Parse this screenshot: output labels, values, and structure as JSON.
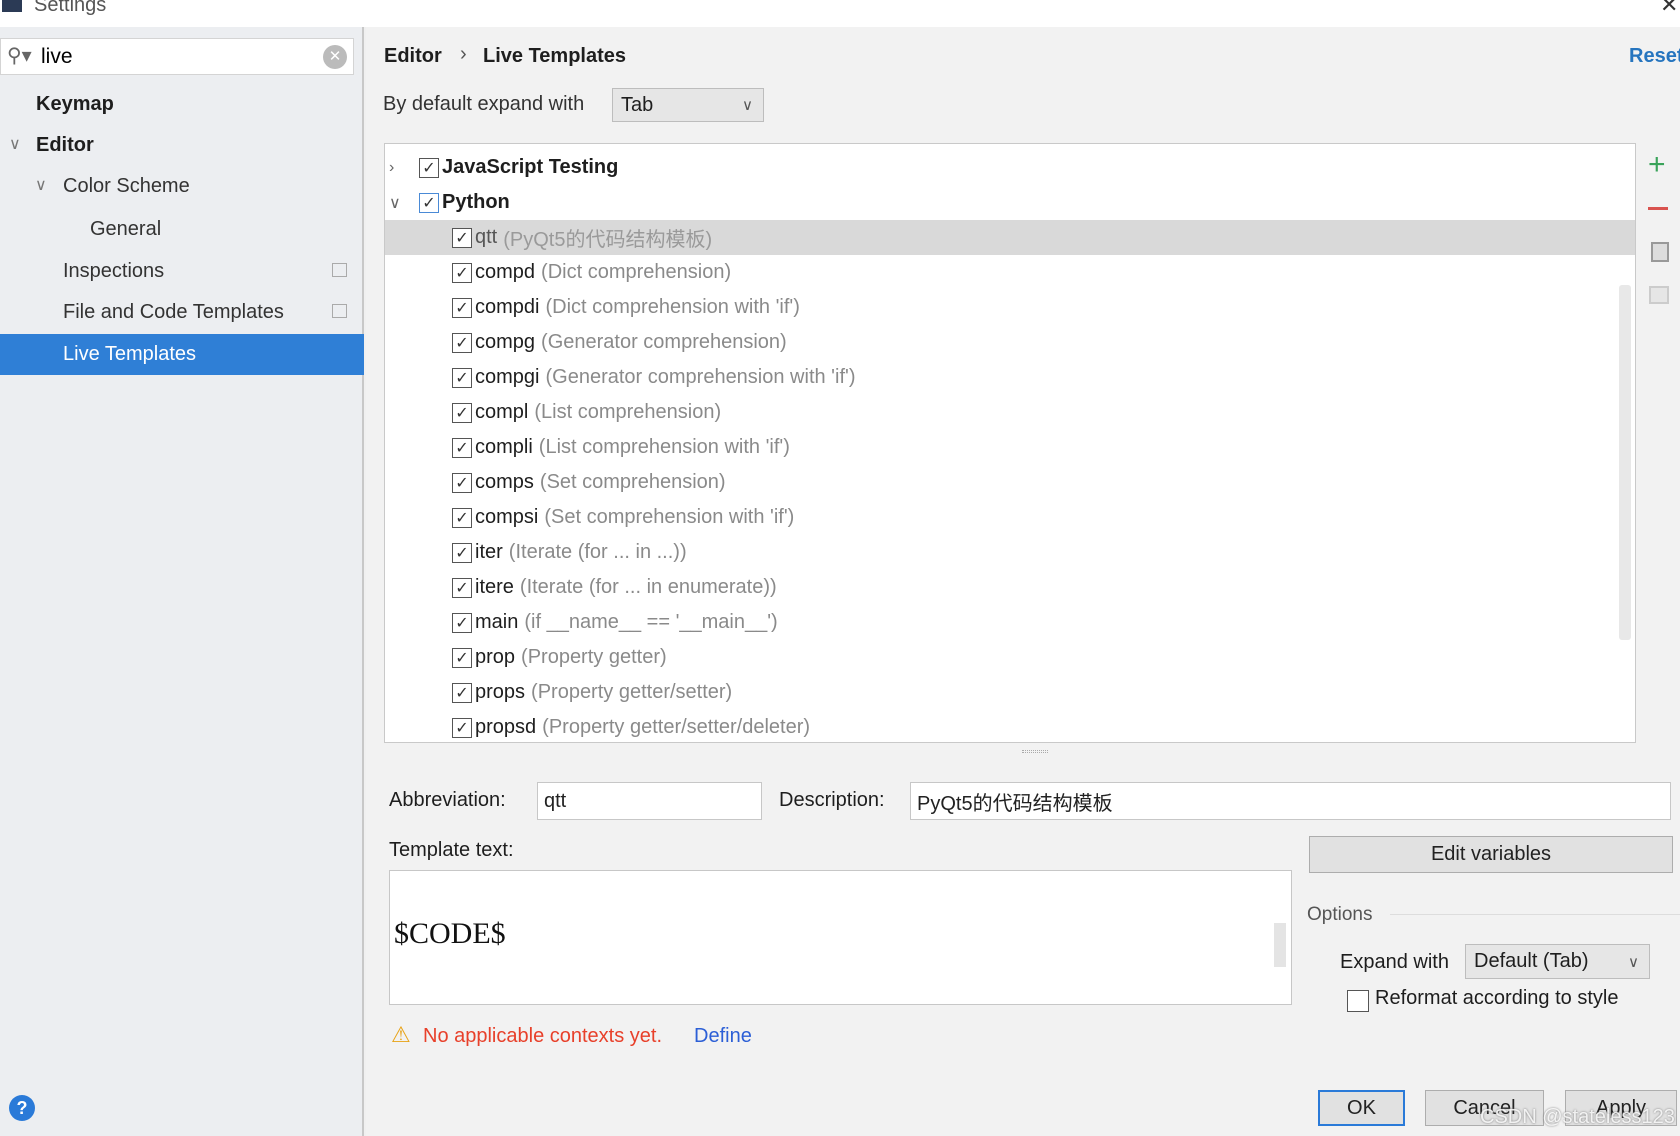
{
  "window": {
    "title": "Settings"
  },
  "search": {
    "value": "live"
  },
  "sidebar": {
    "items": [
      {
        "label": "Keymap",
        "bold": true
      },
      {
        "label": "Editor",
        "bold": true
      },
      {
        "label": "Color Scheme"
      },
      {
        "label": "General"
      },
      {
        "label": "Inspections"
      },
      {
        "label": "File and Code Templates"
      },
      {
        "label": "Live Templates",
        "selected": true
      }
    ]
  },
  "header": {
    "breadcrumb": [
      "Editor",
      "Live Templates"
    ],
    "reset": "Reset"
  },
  "expand": {
    "label": "By default expand with",
    "value": "Tab"
  },
  "tree": {
    "groups": [
      {
        "label": "JavaScript Testing",
        "checked": true,
        "expanded": false
      },
      {
        "label": "Python",
        "checked": true,
        "expanded": true
      }
    ],
    "items": [
      {
        "abbr": "qtt",
        "desc": "(PyQt5的代码结构模板)",
        "selected": true
      },
      {
        "abbr": "compd",
        "desc": "(Dict comprehension)"
      },
      {
        "abbr": "compdi",
        "desc": "(Dict comprehension with 'if')"
      },
      {
        "abbr": "compg",
        "desc": "(Generator comprehension)"
      },
      {
        "abbr": "compgi",
        "desc": "(Generator comprehension with 'if')"
      },
      {
        "abbr": "compl",
        "desc": "(List comprehension)"
      },
      {
        "abbr": "compli",
        "desc": "(List comprehension with 'if')"
      },
      {
        "abbr": "comps",
        "desc": "(Set comprehension)"
      },
      {
        "abbr": "compsi",
        "desc": "(Set comprehension with 'if')"
      },
      {
        "abbr": "iter",
        "desc": "(Iterate (for ... in ...))"
      },
      {
        "abbr": "itere",
        "desc": "(Iterate (for ... in enumerate))"
      },
      {
        "abbr": "main",
        "desc": "(if __name__ == '__main__')"
      },
      {
        "abbr": "prop",
        "desc": "(Property getter)"
      },
      {
        "abbr": "props",
        "desc": "(Property getter/setter)"
      },
      {
        "abbr": "propsd",
        "desc": "(Property getter/setter/deleter)"
      }
    ]
  },
  "editor": {
    "abbreviation_label": "Abbreviation:",
    "abbreviation": "qtt",
    "description_label": "Description:",
    "description": "PyQt5的代码结构模板",
    "template_label": "Template text:",
    "template_text": "$CODE$",
    "edit_variables": "Edit variables",
    "options_label": "Options",
    "expand_with_label": "Expand with",
    "expand_with_value": "Default (Tab)",
    "reformat_label": "Reformat according to style",
    "warning": "No applicable contexts yet.",
    "define": "Define"
  },
  "footer": {
    "ok": "OK",
    "cancel": "Cancel",
    "apply": "Apply",
    "watermark": "CSDN @stateless123"
  },
  "colors": {
    "accent": "#2675bf",
    "selection": "#2f7fd6",
    "warning": "#e8402a",
    "link": "#2c5fd6",
    "add": "#3aa35a",
    "remove": "#d9534f"
  }
}
